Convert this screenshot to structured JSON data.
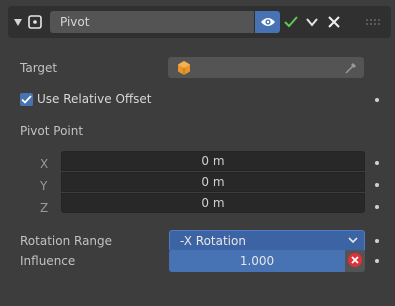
{
  "header": {
    "constraint_name": "Pivot",
    "icons": {
      "expand": "disclosure-triangle-down-icon",
      "type": "pivot-constraint-icon",
      "visibility": "eye-icon",
      "enabled": "checkmark-icon",
      "menu": "chevron-down-icon",
      "delete": "close-icon",
      "drag": "drag-handle-icon"
    }
  },
  "target": {
    "label": "Target",
    "value": "",
    "icons": {
      "object": "object-cube-icon",
      "eyedropper": "eyedropper-icon"
    }
  },
  "use_relative_offset": {
    "label": "Use Relative Offset",
    "checked": true
  },
  "pivot_point": {
    "label": "Pivot Point",
    "x": {
      "label": "X",
      "value": "0 m"
    },
    "y": {
      "label": "Y",
      "value": "0 m"
    },
    "z": {
      "label": "Z",
      "value": "0 m"
    }
  },
  "rotation_range": {
    "label": "Rotation Range",
    "value": "-X Rotation"
  },
  "influence": {
    "label": "Influence",
    "value": "1.000",
    "fraction": 1.0
  },
  "colors": {
    "accent_blue": "#4772b3",
    "panel_bg": "#3d3d3d",
    "header_bg": "#303030",
    "field_bg": "#282828",
    "check_green": "#5cc950",
    "clear_red": "#e0313b"
  }
}
